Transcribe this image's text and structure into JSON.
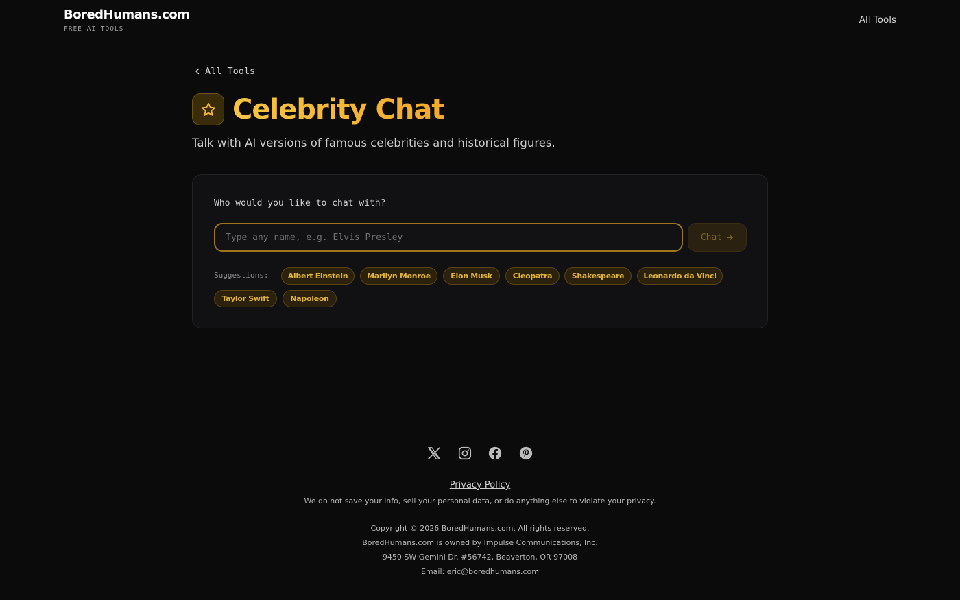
{
  "header": {
    "brand_name": "BoredHumans.com",
    "brand_sub": "FREE AI TOOLS",
    "nav_all_tools": "All Tools"
  },
  "main": {
    "back_link": "All Tools",
    "title_icon": "star-icon",
    "title": "Celebrity Chat",
    "subtitle": "Talk with AI versions of famous celebrities and historical figures."
  },
  "card": {
    "label": "Who would you like to chat with?",
    "input_placeholder": "Type any name, e.g. Elvis Presley",
    "input_value": "",
    "chat_button": "Chat",
    "suggestions_label": "Suggestions:",
    "suggestions": [
      "Albert Einstein",
      "Marilyn Monroe",
      "Elon Musk",
      "Cleopatra",
      "Shakespeare",
      "Leonardo da Vinci",
      "Taylor Swift",
      "Napoleon"
    ]
  },
  "footer": {
    "socials": [
      "x-icon",
      "instagram-icon",
      "facebook-icon",
      "pinterest-icon"
    ],
    "privacy_link": "Privacy Policy",
    "privacy_text": "We do not save your info, sell your personal data, or do anything else to violate your privacy.",
    "copyright": "Copyright © 2026 BoredHumans.com. All rights reserved.",
    "owner": "BoredHumans.com is owned by Impulse Communications, Inc.",
    "address": "9450 SW Gemini Dr. #56742, Beaverton, OR 97008",
    "email": "Email: eric@boredhumans.com"
  },
  "colors": {
    "accent": "#f4b63a",
    "background": "#0b0b0c",
    "chip_bg": "#2b210c"
  }
}
